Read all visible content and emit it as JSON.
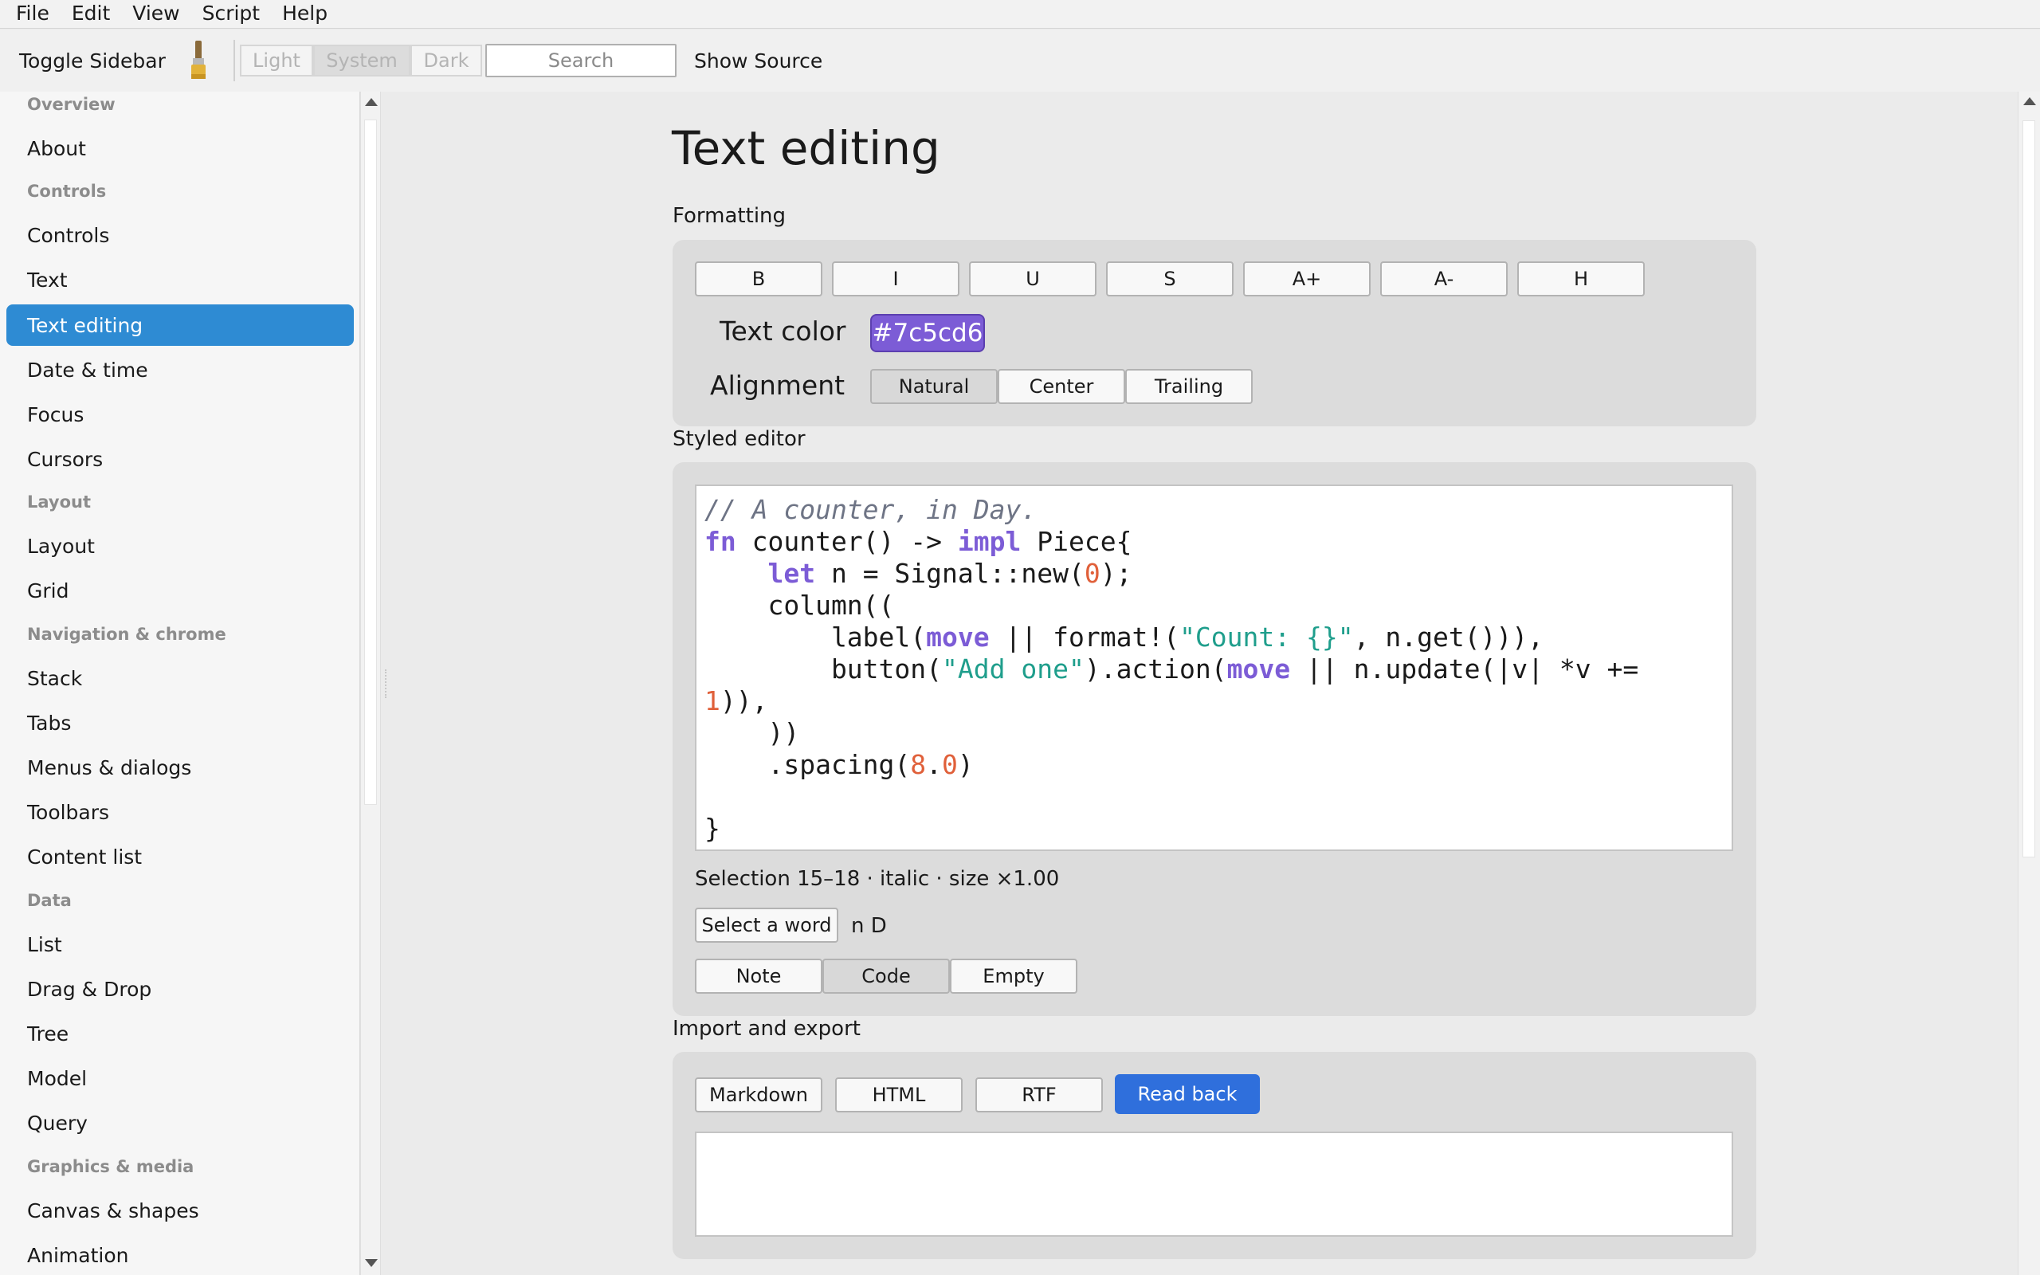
{
  "menubar": {
    "items": [
      "File",
      "Edit",
      "View",
      "Script",
      "Help"
    ]
  },
  "toolbar": {
    "toggle_sidebar": "Toggle Sidebar",
    "theme": {
      "options": [
        "Light",
        "System",
        "Dark"
      ],
      "selected": "System"
    },
    "search_placeholder": "Search",
    "show_source": "Show Source"
  },
  "sidebar": {
    "sections": [
      {
        "heading": "Overview",
        "items": [
          "About"
        ]
      },
      {
        "heading": "Controls",
        "items": [
          "Controls",
          "Text",
          "Text editing",
          "Date & time",
          "Focus",
          "Cursors"
        ]
      },
      {
        "heading": "Layout",
        "items": [
          "Layout",
          "Grid"
        ]
      },
      {
        "heading": "Navigation & chrome",
        "items": [
          "Stack",
          "Tabs",
          "Menus & dialogs",
          "Toolbars",
          "Content list"
        ]
      },
      {
        "heading": "Data",
        "items": [
          "List",
          "Drag & Drop",
          "Tree",
          "Model",
          "Query"
        ]
      },
      {
        "heading": "Graphics & media",
        "items": [
          "Canvas & shapes",
          "Animation"
        ]
      }
    ],
    "active": "Text editing"
  },
  "main": {
    "title": "Text editing",
    "formatting": {
      "label": "Formatting",
      "buttons": [
        "B",
        "I",
        "U",
        "S",
        "A+",
        "A-",
        "H"
      ],
      "text_color_label": "Text color",
      "text_color_value": "#7c5cd6",
      "alignment_label": "Alignment",
      "alignment_options": [
        "Natural",
        "Center",
        "Trailing"
      ],
      "alignment_selected": "Natural"
    },
    "styled_editor": {
      "label": "Styled editor",
      "code": [
        "// A counter, in Day.",
        "fn counter() -> impl Piece{",
        "    let n = Signal::new(0);",
        "    column((",
        "        label(move || format!(\"Count: {}\", n.get())),",
        "        button(\"Add one\").action(move || n.update(|v| *v +=",
        "1)),",
        "    ))",
        "    .spacing(8.0)",
        "",
        "}"
      ],
      "selection_info": "Selection 15–18 · italic · size ×1.00",
      "select_word_button": "Select a word",
      "selected_word": "n D",
      "presets": [
        "Note",
        "Code",
        "Empty"
      ],
      "preset_selected": "Code"
    },
    "import_export": {
      "label": "Import and export",
      "buttons": [
        "Markdown",
        "HTML",
        "RTF"
      ],
      "read_back": "Read back",
      "output": ""
    }
  },
  "colors": {
    "accent_sidebar": "#2e8bd3",
    "primary_button": "#2f6fdc",
    "text_color_swatch": "#7c5cd6",
    "code_keyword": "#7c5cd6",
    "code_string": "#1f9e8c",
    "code_number": "#e0603a",
    "code_comment": "#6e7485"
  }
}
